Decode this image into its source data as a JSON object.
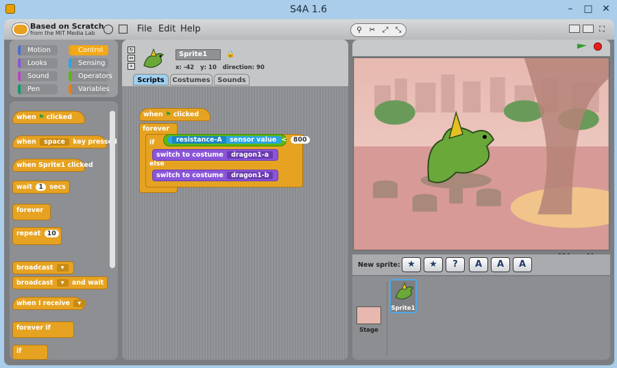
{
  "window": {
    "title": "S4A 1.6",
    "minimize": "–",
    "maximize": "□",
    "close": "✕"
  },
  "app": {
    "logo_line1": "Based on Scratch",
    "logo_line2": "from the MIT Media Lab",
    "menus": [
      "File",
      "Edit",
      "Help"
    ]
  },
  "categories": [
    {
      "label": "Motion",
      "color": "#4a6cd4"
    },
    {
      "label": "Control",
      "color": "#e6a322"
    },
    {
      "label": "Looks",
      "color": "#8a55d7"
    },
    {
      "label": "Sensing",
      "color": "#2ca5e2"
    },
    {
      "label": "Sound",
      "color": "#bb42c3"
    },
    {
      "label": "Operators",
      "color": "#5cb712"
    },
    {
      "label": "Pen",
      "color": "#0e9a6c"
    },
    {
      "label": "Variables",
      "color": "#ee7d16"
    }
  ],
  "palette": {
    "when_flag": [
      "when",
      "clicked"
    ],
    "when_key": [
      "when",
      "space",
      "key pressed"
    ],
    "when_sprite": [
      "when Sprite1 clicked"
    ],
    "wait": [
      "wait",
      "1",
      "secs"
    ],
    "forever": "forever",
    "repeat": [
      "repeat",
      "10"
    ],
    "broadcast": "broadcast",
    "broadcast_wait": [
      "broadcast",
      "and wait"
    ],
    "when_receive": "when I receive",
    "forever_if": "forever if",
    "if": "if"
  },
  "sprite": {
    "name": "Sprite1",
    "x_label": "x:",
    "x": "-42",
    "y_label": "y:",
    "y": "10",
    "dir_label": "direction:",
    "direction": "90"
  },
  "tabs": [
    "Scripts",
    "Costumes",
    "Sounds"
  ],
  "script": {
    "hat": [
      "when",
      "clicked"
    ],
    "forever": "forever",
    "if": "if",
    "sensor": "resistance-A",
    "sensor_value": "sensor value",
    "lt": "<",
    "threshold": "800",
    "switch1": "switch to costume",
    "costume_a": "dragon1-a",
    "else": "else",
    "switch2": "switch to costume",
    "costume_b": "dragon1-b"
  },
  "stage_mouse": {
    "x_label": "x:",
    "x": "194",
    "y_label": "y:",
    "y": "11"
  },
  "new_sprite_label": "New sprite:",
  "library": {
    "stage_label": "Stage",
    "sprite_label": "Sprite1"
  },
  "colors": {
    "control": "#e6a322",
    "looks": "#8a55d7",
    "sensing": "#2ca5e2",
    "operators": "#5cb712",
    "accent_tab": "#9ed0f0"
  }
}
